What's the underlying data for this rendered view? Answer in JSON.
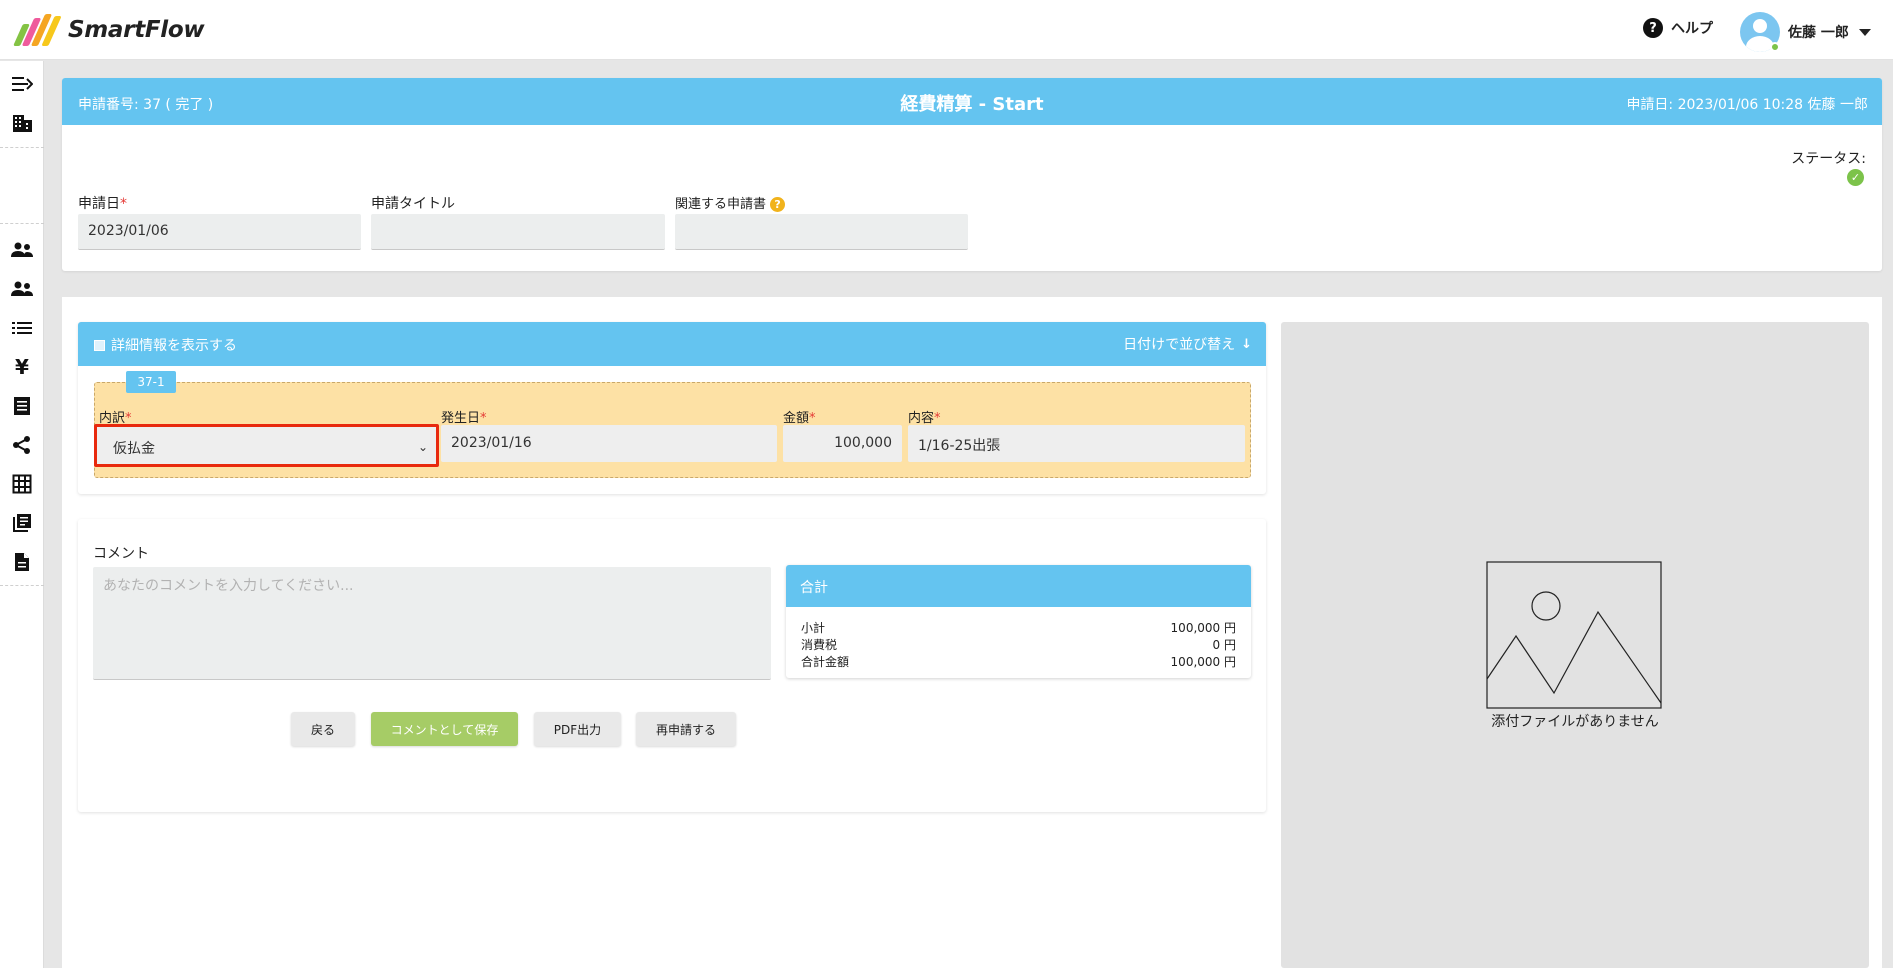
{
  "app": {
    "logo_text": "SmartFlow",
    "logo_colors": [
      "#84c344",
      "#ef5b9c",
      "#f7b21c",
      "#f5a623"
    ],
    "help_label": "ヘルプ",
    "user_name": "佐藤 一郎"
  },
  "sidebar": {
    "items": [
      "collapse-icon",
      "building-icon",
      "users-icon",
      "users-group-icon",
      "list-icon",
      "yen-icon",
      "receipt-icon",
      "share-icon",
      "table-icon",
      "library-icon",
      "document-icon"
    ]
  },
  "header": {
    "request_no": "申請番号: 37 ( 完了 )",
    "title": "経費精算 - Start",
    "request_meta": "申請日: 2023/01/06 10:28 佐藤 一郎",
    "status_label": "ステータス:",
    "status_color": "#7cc34a"
  },
  "form": {
    "date_label": "申請日",
    "date_value": "2023/01/06",
    "title_label": "申請タイトル",
    "title_value": "",
    "related_label": "関連する申請書",
    "related_value": ""
  },
  "details": {
    "toggle_label": "詳細情報を表示する",
    "sort_label": "日付けで並び替え",
    "row_tag": "37-1",
    "category_label": "内訳",
    "category_value": "仮払金",
    "date_label": "発生日",
    "date_value": "2023/01/16",
    "amount_label": "金額",
    "amount_value": "100,000",
    "content_label": "内容",
    "content_value": "1/16-25出張"
  },
  "comment": {
    "label": "コメント",
    "placeholder": "あなたのコメントを入力してください..."
  },
  "totals": {
    "title": "合計",
    "rows": [
      {
        "label": "小計",
        "value": "100,000 円"
      },
      {
        "label": "消費税",
        "value": "0 円"
      },
      {
        "label": "合計金額",
        "value": "100,000 円"
      }
    ]
  },
  "buttons": {
    "back": "戻る",
    "save_comment": "コメントとして保存",
    "pdf": "PDF出力",
    "reapply": "再申請する"
  },
  "attachment": {
    "empty_text": "添付ファイルがありません"
  },
  "colors": {
    "accent_blue": "#64c4f0",
    "row_bg": "#fde1a5",
    "highlight_red": "#e8290d",
    "save_green": "#a6cc66"
  }
}
